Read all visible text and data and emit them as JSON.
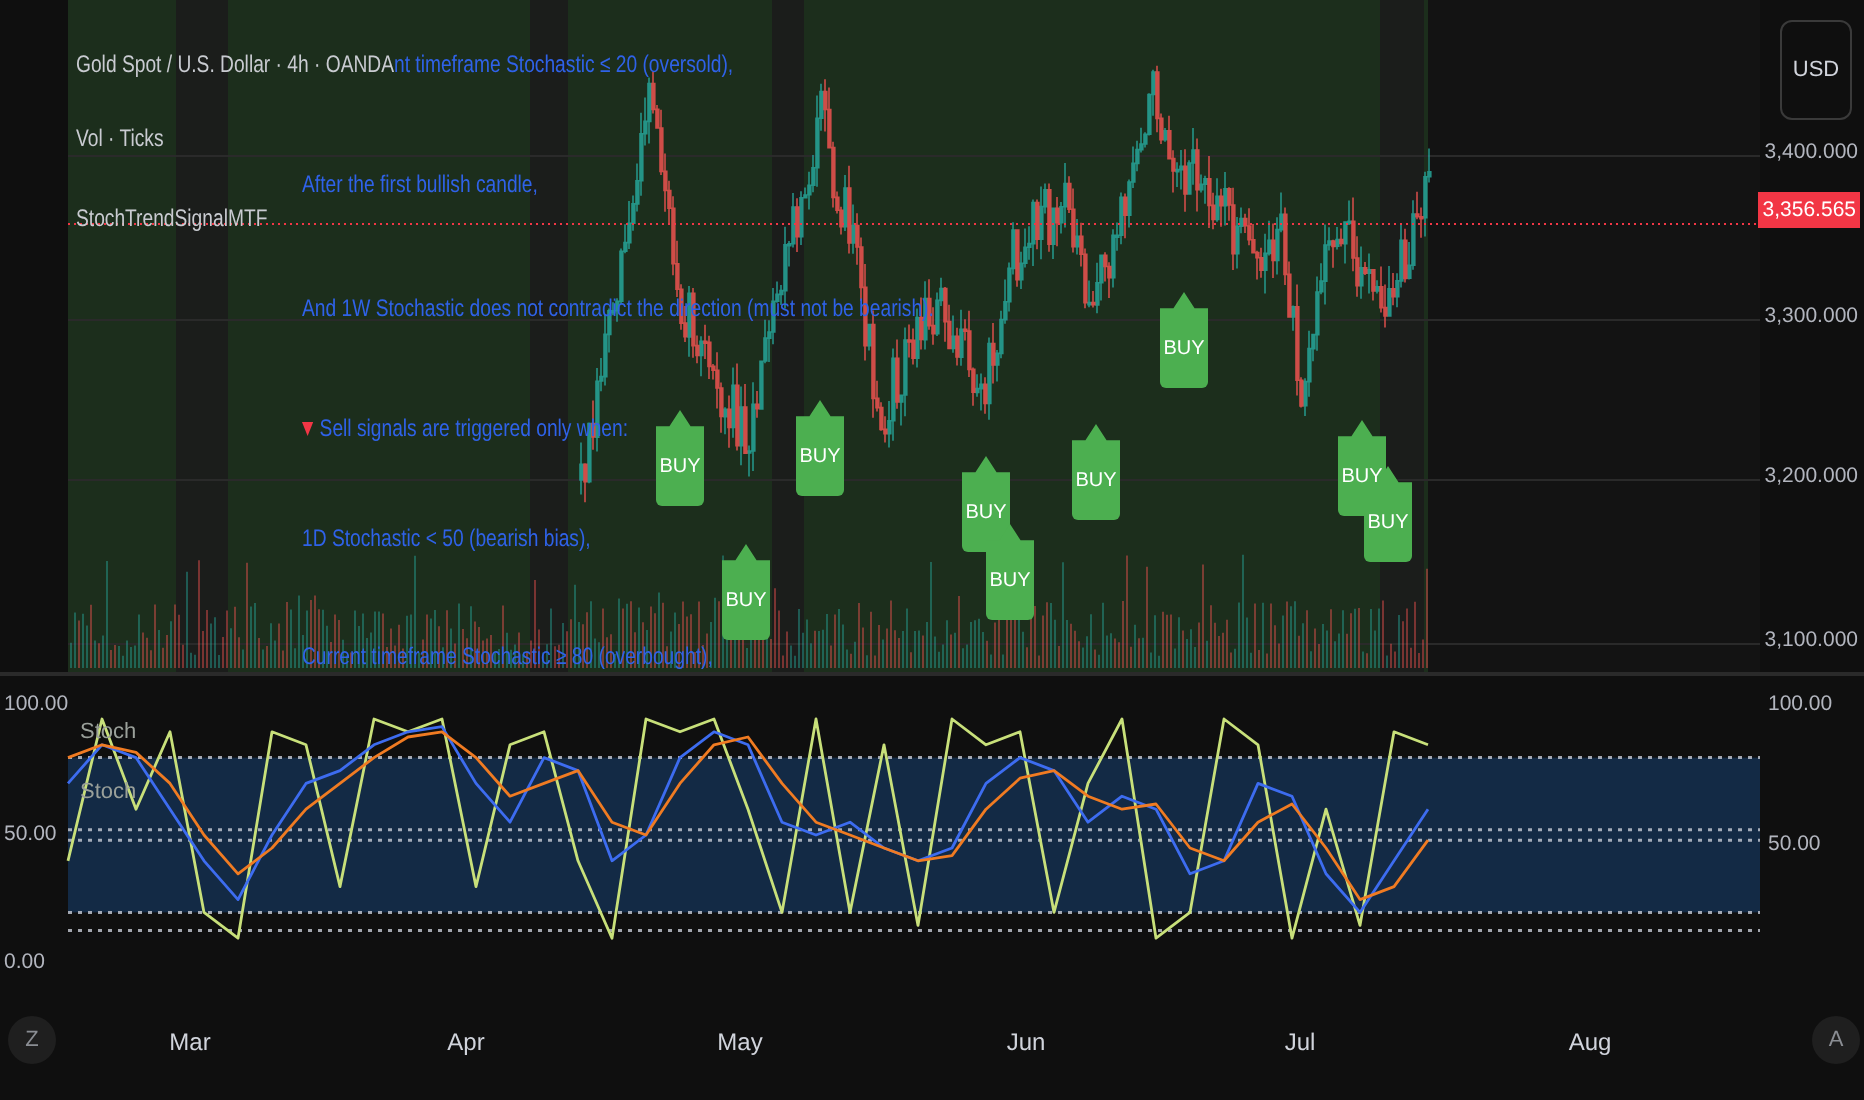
{
  "legend": {
    "symbol": "Gold Spot / U.S. Dollar · 4h · OANDA",
    "indicators": [
      "Vol · Ticks",
      "StochTrendSignalMTF"
    ]
  },
  "script_notes": [
    {
      "kind": "plain",
      "text": "nt timeframe Stochastic ≤ 20 (oversold),"
    },
    {
      "kind": "plain",
      "text": "After the first bullish candle,"
    },
    {
      "kind": "plain",
      "text": "And 1W Stochastic does not contradict the direction (must not be bearish)."
    },
    {
      "kind": "sell",
      "text": "Sell signals are triggered only when:"
    },
    {
      "kind": "plain",
      "text": "1D Stochastic < 50 (bearish bias),"
    },
    {
      "kind": "plain",
      "text": "Current timeframe Stochastic ≥ 80 (overbought),"
    }
  ],
  "signals": [
    {
      "label": "BUY"
    },
    {
      "label": "BUY"
    },
    {
      "label": "BUY"
    },
    {
      "label": "BUY"
    },
    {
      "label": "BUY"
    },
    {
      "label": "BUY"
    },
    {
      "label": "BUY"
    },
    {
      "label": "BUY"
    },
    {
      "label": "BUY"
    }
  ],
  "price_axis": {
    "currency_button": "USD",
    "ticks": [
      "3,400.000",
      "3,300.000",
      "3,200.000",
      "3,100.000"
    ],
    "last_price": "3,356.565"
  },
  "oscillator": {
    "series_labels": [
      "Stoch",
      "Stoch"
    ],
    "right_ticks": [
      "100.00",
      "50.00"
    ],
    "chart_data": {
      "type": "line",
      "ylim": [
        0,
        100
      ],
      "yticks": [
        {
          "value": 100,
          "label": "100.00"
        },
        {
          "value": 50,
          "label": "50.00"
        },
        {
          "value": 0,
          "label": "0.00"
        }
      ],
      "series": [
        {
          "color": "#c8e07a",
          "values": [
            40,
            95,
            60,
            90,
            20,
            10,
            90,
            85,
            30,
            95,
            90,
            95,
            30,
            85,
            90,
            40,
            10,
            95,
            90,
            95,
            60,
            20,
            95,
            20,
            85,
            15,
            95,
            85,
            90,
            20,
            70,
            95,
            10,
            20,
            95,
            85,
            10,
            60,
            15,
            90,
            85
          ]
        },
        {
          "color": "#3d6cf0",
          "values": [
            70,
            85,
            80,
            60,
            40,
            25,
            50,
            70,
            75,
            85,
            90,
            92,
            70,
            55,
            80,
            75,
            40,
            50,
            80,
            90,
            85,
            55,
            50,
            55,
            45,
            40,
            45,
            70,
            80,
            75,
            55,
            65,
            60,
            35,
            40,
            70,
            65,
            35,
            20,
            40,
            60
          ]
        },
        {
          "color": "#f07b22",
          "values": [
            80,
            85,
            82,
            70,
            50,
            35,
            45,
            60,
            70,
            80,
            88,
            90,
            80,
            65,
            70,
            75,
            55,
            50,
            70,
            85,
            88,
            70,
            55,
            50,
            45,
            40,
            42,
            60,
            72,
            75,
            65,
            60,
            62,
            45,
            40,
            55,
            62,
            45,
            25,
            30,
            48
          ]
        }
      ]
    }
  },
  "time_axis": {
    "left_button": "Z",
    "months": [
      "Mar",
      "Apr",
      "May",
      "Jun",
      "Jul",
      "Aug"
    ],
    "right_button": "A"
  }
}
